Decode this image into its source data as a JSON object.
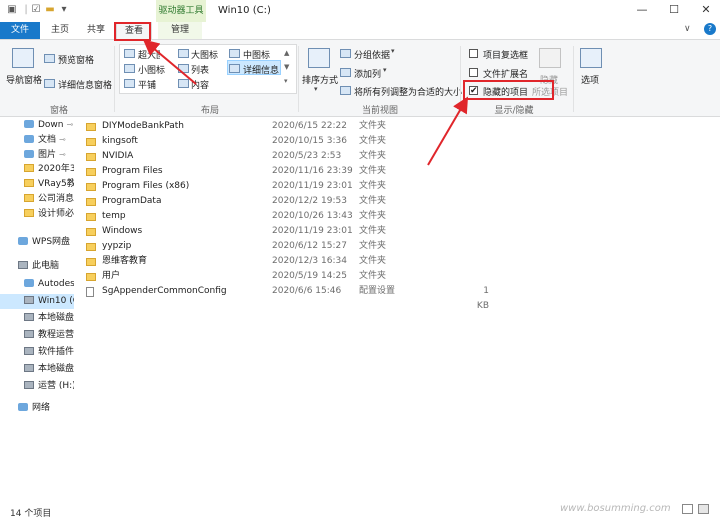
{
  "window": {
    "title": "Win10 (C:)",
    "context_tab": "驱动器工具",
    "minimize_glyph": "—",
    "maximize_glyph": "☐",
    "close_glyph": "✕",
    "expand_glyph": "∨",
    "help_glyph": "?"
  },
  "tabs": {
    "file": "文件",
    "home": "主页",
    "share": "共享",
    "view": "查看",
    "manage": "管理"
  },
  "ribbon": {
    "panes": {
      "nav_pane": "导航窗格",
      "preview_pane": "预览窗格",
      "details_pane": "详细信息窗格",
      "group_label": "窗格"
    },
    "layout": {
      "extra_large": "超大图标",
      "large": "大图标",
      "medium": "中图标",
      "small": "小图标",
      "list": "列表",
      "details": "详细信息",
      "tiles": "平铺",
      "content": "内容",
      "group_label": "布局"
    },
    "current_view": {
      "sort_by": "排序方式",
      "group_by": "分组依据",
      "add_columns": "添加列",
      "size_columns": "将所有列调整为合适的大小",
      "group_label": "当前视图"
    },
    "show_hide": {
      "item_checkboxes": "项目复选框",
      "file_extensions": "文件扩展名",
      "hidden_items": "隐藏的项目",
      "hidden_items_checked": "✔",
      "hide_selected_line1": "隐藏",
      "hide_selected_line2": "所选项目",
      "group_label": "显示/隐藏"
    },
    "options": "选项"
  },
  "nav": {
    "items": [
      {
        "label": "Down",
        "pinned": true,
        "icon": "download-icon"
      },
      {
        "label": "文档",
        "pinned": true,
        "icon": "document-icon"
      },
      {
        "label": "图片",
        "pinned": true,
        "icon": "picture-icon"
      },
      {
        "label": "2020年3",
        "pinned": false,
        "icon": "folder-icon"
      },
      {
        "label": "VRay5教",
        "pinned": false,
        "icon": "folder-icon"
      },
      {
        "label": "公司消息",
        "pinned": false,
        "icon": "folder-icon"
      },
      {
        "label": "设计师必",
        "pinned": false,
        "icon": "folder-icon"
      },
      {
        "label": "WPS网盘",
        "pinned": false,
        "icon": "cloud-icon"
      },
      {
        "label": "此电脑",
        "pinned": false,
        "icon": "computer-icon"
      },
      {
        "label": "Autodes",
        "pinned": false,
        "icon": "cloud-icon"
      },
      {
        "label": "Win10 (C",
        "pinned": false,
        "icon": "drive-icon"
      },
      {
        "label": "本地磁盘",
        "pinned": false,
        "icon": "drive-icon"
      },
      {
        "label": "教程运营",
        "pinned": false,
        "icon": "drive-icon"
      },
      {
        "label": "软件插件",
        "pinned": false,
        "icon": "drive-icon"
      },
      {
        "label": "本地磁盘",
        "pinned": false,
        "icon": "drive-icon"
      },
      {
        "label": "运营 (H:)",
        "pinned": false,
        "icon": "drive-icon"
      },
      {
        "label": "网络",
        "pinned": false,
        "icon": "network-icon"
      }
    ]
  },
  "files": [
    {
      "name": "DIYModeBankPath",
      "date": "2020/6/15 22:22",
      "type": "文件夹",
      "size": ""
    },
    {
      "name": "kingsoft",
      "date": "2020/10/15 3:36",
      "type": "文件夹",
      "size": ""
    },
    {
      "name": "NVIDIA",
      "date": "2020/5/23 2:53",
      "type": "文件夹",
      "size": ""
    },
    {
      "name": "Program Files",
      "date": "2020/11/16 23:39",
      "type": "文件夹",
      "size": ""
    },
    {
      "name": "Program Files (x86)",
      "date": "2020/11/19 23:01",
      "type": "文件夹",
      "size": ""
    },
    {
      "name": "ProgramData",
      "date": "2020/12/2 19:53",
      "type": "文件夹",
      "size": ""
    },
    {
      "name": "temp",
      "date": "2020/10/26 13:43",
      "type": "文件夹",
      "size": ""
    },
    {
      "name": "Windows",
      "date": "2020/11/19 23:01",
      "type": "文件夹",
      "size": ""
    },
    {
      "name": "yypzip",
      "date": "2020/6/12 15:27",
      "type": "文件夹",
      "size": ""
    },
    {
      "name": "恩维客教育",
      "date": "2020/12/3 16:34",
      "type": "文件夹",
      "size": ""
    },
    {
      "name": "用户",
      "date": "2020/5/19 14:25",
      "type": "文件夹",
      "size": ""
    },
    {
      "name": "SgAppenderCommonConfig",
      "date": "2020/6/6 15:46",
      "type": "配置设置",
      "size": "1 KB"
    }
  ],
  "status": {
    "item_count": "14 个项目"
  },
  "watermark": "www.bosumming.com"
}
